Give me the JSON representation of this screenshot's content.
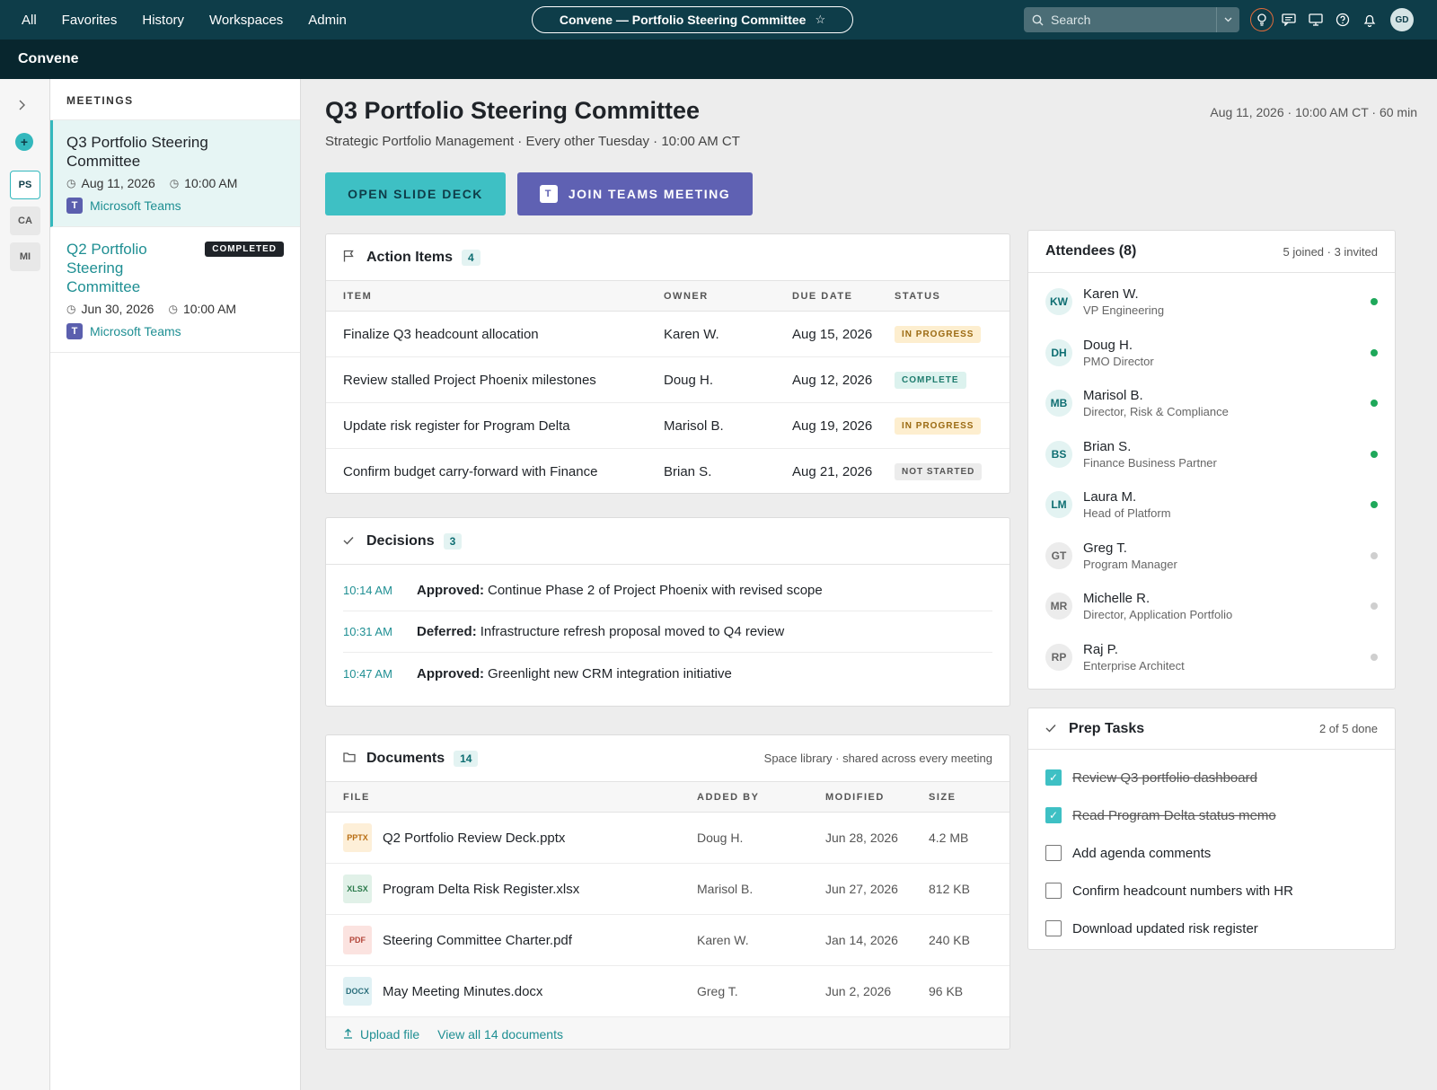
{
  "topnav": {
    "items": [
      "All",
      "Favorites",
      "History",
      "Workspaces",
      "Admin"
    ],
    "context_title": "Convene — Portfolio Steering Committee",
    "search_placeholder": "Search",
    "user_initials": "GD"
  },
  "brand": "Convene",
  "rail": {
    "tiles": [
      "PS",
      "CA",
      "MI"
    ]
  },
  "meetings": {
    "header": "MEETINGS",
    "items": [
      {
        "title": "Q3 Portfolio Steering Committee",
        "date": "Aug 11, 2026",
        "time": "10:00 AM",
        "location": "Microsoft Teams",
        "badge": ""
      },
      {
        "title": "Q2 Portfolio Steering Committee",
        "date": "Jun 30, 2026",
        "time": "10:00 AM",
        "location": "Microsoft Teams",
        "badge": "COMPLETED"
      }
    ]
  },
  "page": {
    "title": "Q3 Portfolio Steering Committee",
    "subtitle": "Strategic Portfolio Management · Every other Tuesday · 10:00 AM CT",
    "when": "Aug 11, 2026 · 10:00 AM CT · 60 min",
    "open_deck_label": "OPEN SLIDE DECK",
    "join_teams_label": "JOIN TEAMS MEETING"
  },
  "action_items": {
    "title": "Action Items",
    "count": "4",
    "columns": [
      "ITEM",
      "OWNER",
      "DUE DATE",
      "STATUS"
    ],
    "rows": [
      {
        "item": "Finalize Q3 headcount allocation",
        "owner": "Karen W.",
        "due": "Aug 15, 2026",
        "status": "IN PROGRESS"
      },
      {
        "item": "Review stalled Project Phoenix milestones",
        "owner": "Doug H.",
        "due": "Aug 12, 2026",
        "status": "COMPLETE"
      },
      {
        "item": "Update risk register for Program Delta",
        "owner": "Marisol B.",
        "due": "Aug 19, 2026",
        "status": "IN PROGRESS"
      },
      {
        "item": "Confirm budget carry-forward with Finance",
        "owner": "Brian S.",
        "due": "Aug 21, 2026",
        "status": "NOT STARTED"
      }
    ]
  },
  "decisions": {
    "title": "Decisions",
    "count": "3",
    "rows": [
      {
        "time": "10:14 AM",
        "kind": "Approved:",
        "text": "Continue Phase 2 of Project Phoenix with revised scope"
      },
      {
        "time": "10:31 AM",
        "kind": "Deferred:",
        "text": "Infrastructure refresh proposal moved to Q4 review"
      },
      {
        "time": "10:47 AM",
        "kind": "Approved:",
        "text": "Greenlight new CRM integration initiative"
      }
    ]
  },
  "documents": {
    "title": "Documents",
    "count": "14",
    "note": "Space library · shared across every meeting",
    "columns": [
      "FILE",
      "ADDED BY",
      "MODIFIED",
      "SIZE"
    ],
    "rows": [
      {
        "type": "PPTX",
        "name": "Q2 Portfolio Review Deck.pptx",
        "by": "Doug H.",
        "modified": "Jun 28, 2026",
        "size": "4.2 MB"
      },
      {
        "type": "XLSX",
        "name": "Program Delta Risk Register.xlsx",
        "by": "Marisol B.",
        "modified": "Jun 27, 2026",
        "size": "812 KB"
      },
      {
        "type": "PDF",
        "name": "Steering Committee Charter.pdf",
        "by": "Karen W.",
        "modified": "Jan 14, 2026",
        "size": "240 KB"
      },
      {
        "type": "DOCX",
        "name": "May Meeting Minutes.docx",
        "by": "Greg T.",
        "modified": "Jun 2, 2026",
        "size": "96 KB"
      }
    ],
    "upload_label": "Upload file",
    "view_all_label": "View all 14 documents"
  },
  "attendees": {
    "title": "Attendees (8)",
    "summary": "5 joined · 3 invited",
    "people": [
      {
        "initials": "KW",
        "name": "Karen W.",
        "role": "VP Engineering",
        "joined": true
      },
      {
        "initials": "DH",
        "name": "Doug H.",
        "role": "PMO Director",
        "joined": true
      },
      {
        "initials": "MB",
        "name": "Marisol B.",
        "role": "Director, Risk & Compliance",
        "joined": true
      },
      {
        "initials": "BS",
        "name": "Brian S.",
        "role": "Finance Business Partner",
        "joined": true
      },
      {
        "initials": "LM",
        "name": "Laura M.",
        "role": "Head of Platform",
        "joined": true
      },
      {
        "initials": "GT",
        "name": "Greg T.",
        "role": "Program Manager",
        "joined": false
      },
      {
        "initials": "MR",
        "name": "Michelle R.",
        "role": "Director, Application Portfolio",
        "joined": false
      },
      {
        "initials": "RP",
        "name": "Raj P.",
        "role": "Enterprise Architect",
        "joined": false
      }
    ]
  },
  "prep_tasks": {
    "title": "Prep Tasks",
    "summary": "2 of 5 done",
    "tasks": [
      {
        "label": "Review Q3 portfolio dashboard",
        "done": true
      },
      {
        "label": "Read Program Delta status memo",
        "done": true
      },
      {
        "label": "Add agenda comments",
        "done": false
      },
      {
        "label": "Confirm headcount numbers with HR",
        "done": false
      },
      {
        "label": "Download updated risk register",
        "done": false
      }
    ]
  }
}
